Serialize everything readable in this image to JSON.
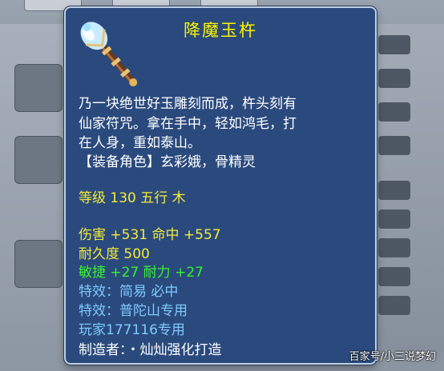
{
  "item": {
    "icon": "jade-pestle-icon",
    "title": "降魔玉杵",
    "desc": [
      "乃一块绝世好玉雕刻而成，杵头刻有",
      "仙家符咒。拿在手中，轻如鸿毛，打",
      "在人身，重如泰山。"
    ],
    "equip_roles": "【装备角色】玄彩娥，骨精灵",
    "level_line": "等级 130   五行 木",
    "attack_line": "伤害 +531  命中 +557",
    "durability_line": "耐久度 500",
    "agility_line": "敏捷 +27  耐力 +27",
    "effect1": "特效：简易 必中",
    "effect2": "特效：普陀山专用",
    "owner": "玩家177116专用",
    "maker": "制造者：・灿灿强化打造"
  },
  "watermark": "百家号/小三说梦幻",
  "colors": {
    "panel_bg": "#2a4a7d",
    "title": "#fcf400",
    "stat": "#f3ea3a",
    "bonus": "#38f030",
    "effect": "#7fcaff"
  }
}
